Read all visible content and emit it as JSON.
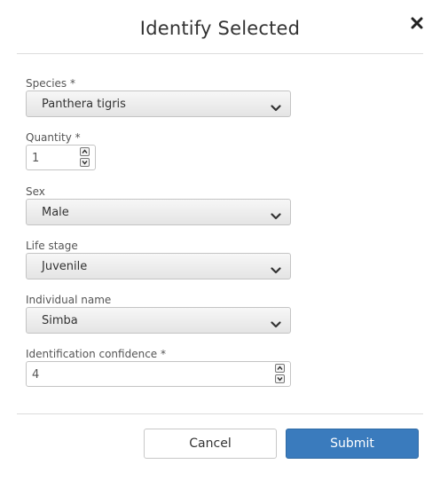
{
  "dialog": {
    "title": "Identify Selected",
    "close_icon": "close-x-icon"
  },
  "fields": {
    "species": {
      "label": "Species *",
      "value": "Panthera tigris"
    },
    "quantity": {
      "label": "Quantity *",
      "value": "1"
    },
    "sex": {
      "label": "Sex",
      "value": "Male"
    },
    "life_stage": {
      "label": "Life stage",
      "value": "Juvenile"
    },
    "individual_name": {
      "label": "Individual name",
      "value": "Simba"
    },
    "confidence": {
      "label": "Identification confidence *",
      "value": "4"
    }
  },
  "actions": {
    "cancel_label": "Cancel",
    "submit_label": "Submit"
  },
  "colors": {
    "primary": "#3a7bbd",
    "border": "#c4c4c4",
    "divider": "#dcdcdc"
  },
  "icons": {
    "select_arrow": "chevron-down-icon",
    "stepper_up": "chevron-up-icon",
    "stepper_down": "chevron-down-icon"
  }
}
